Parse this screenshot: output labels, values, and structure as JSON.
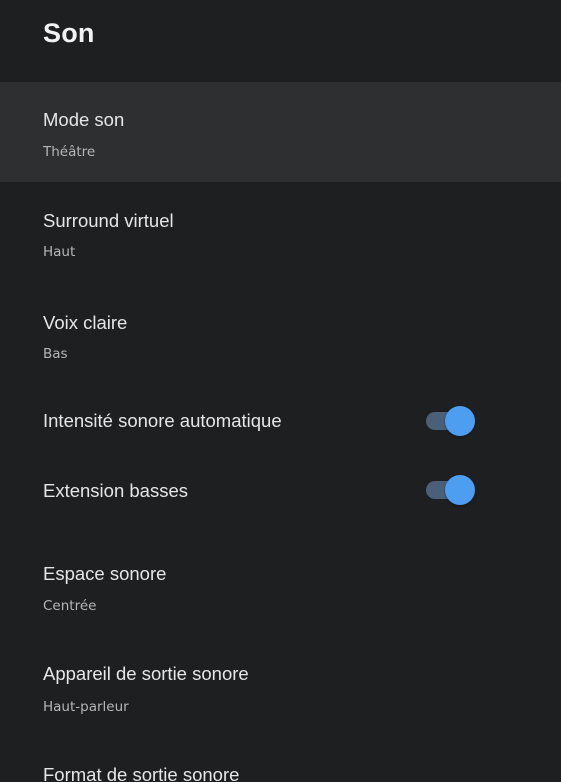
{
  "header": {
    "title": "Son"
  },
  "items": [
    {
      "title": "Mode son",
      "subtitle": "Théâtre"
    },
    {
      "title": "Surround virtuel",
      "subtitle": "Haut"
    },
    {
      "title": "Voix claire",
      "subtitle": "Bas"
    },
    {
      "title": "Intensité sonore automatique",
      "toggle": true
    },
    {
      "title": "Extension basses",
      "toggle": true
    },
    {
      "title": "Espace sonore",
      "subtitle": "Centrée"
    },
    {
      "title": "Appareil de sortie sonore",
      "subtitle": "Haut-parleur"
    },
    {
      "title": "Format de sortie sonore"
    }
  ],
  "colors": {
    "background": "#1e1f21",
    "focused_row": "#2e2f31",
    "toggle_thumb": "#4d9ef0",
    "toggle_track": "#4a5f78"
  }
}
